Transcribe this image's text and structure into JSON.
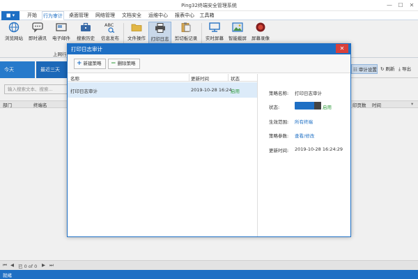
{
  "window": {
    "title": "Ping32终端安全管理系统"
  },
  "menu": {
    "app_label": "■ ▾",
    "tabs": [
      "开始",
      "行为审计",
      "桌面管理",
      "网络管理",
      "文档安全",
      "运维中心",
      "报表中心",
      "工具箱"
    ],
    "active": "行为审计"
  },
  "ribbon": {
    "buttons": [
      "浏览网站",
      "即时通讯",
      "电子邮件",
      "搜索历史",
      "信息发布",
      "文件操作",
      "打印日志",
      "剪切板记录",
      "实时屏幕",
      "智能截屏",
      "屏幕录像"
    ],
    "active": "打印日志",
    "group_label": "上网行"
  },
  "background": {
    "date_tabs": [
      "今天",
      "最近三天"
    ],
    "toolbar": {
      "settings": "审计设置",
      "refresh": "刷新",
      "export": "导出"
    },
    "search_placeholder": "输入搜索文本、搜索...",
    "grid_headers": [
      "部门",
      "终端名",
      "印页数",
      "时间"
    ],
    "pager_text": "已 0 of 0",
    "status_text": "就绪"
  },
  "dialog": {
    "title": "打印日志审计",
    "close_symbol": "✕",
    "toolbar": {
      "new_label": "新建策略",
      "delete_label": "删除策略"
    },
    "list": {
      "headers": {
        "name": "名称",
        "updated": "更新时间",
        "status": "状态"
      },
      "rows": [
        {
          "name": "打印日志审计",
          "updated": "2019-10-28 16:24",
          "status": "启用"
        }
      ]
    },
    "props": {
      "name_label": "策略名称:",
      "name_value": "打印日志审计",
      "status_label": "状态:",
      "status_value": "启用",
      "scope_label": "生效范围:",
      "scope_value": "所有终端",
      "params_label": "策略参数:",
      "params_value": "查看/修改",
      "updated_label": "更新时间:",
      "updated_value": "2019-10-28 16:24:29"
    }
  },
  "colors": {
    "accent": "#1e6fc4",
    "enabled": "#2e9a3a",
    "close": "#d9403a"
  }
}
